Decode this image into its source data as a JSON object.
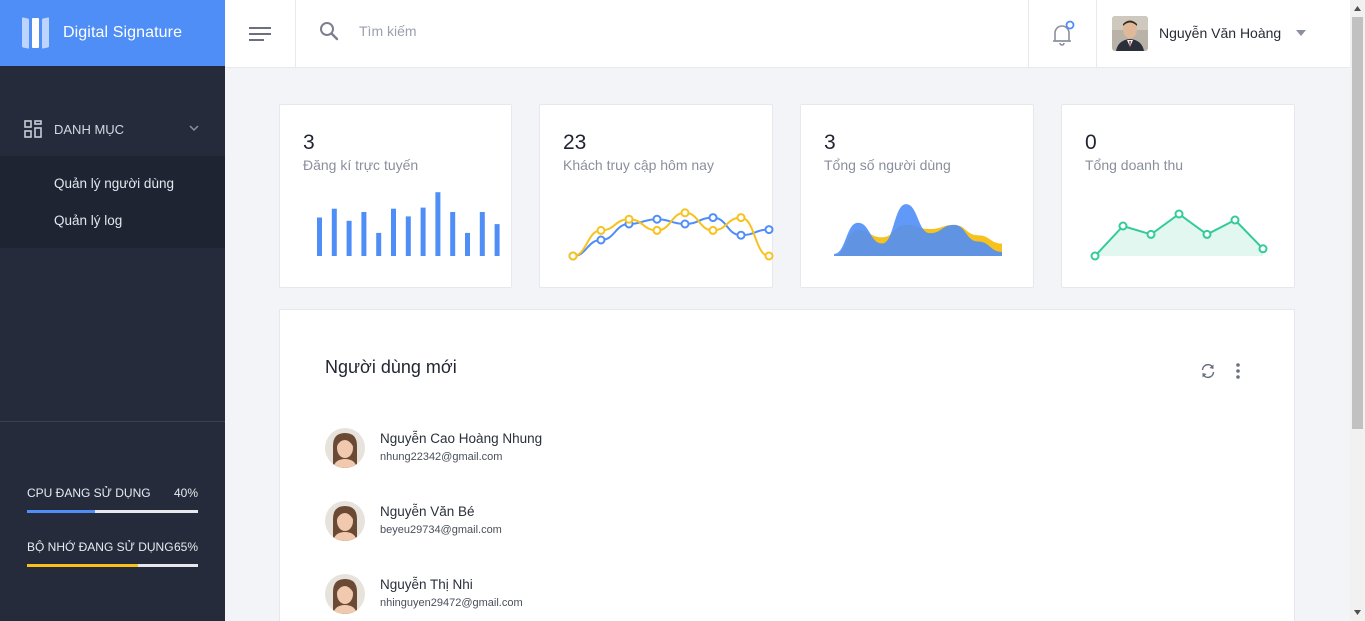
{
  "brand": {
    "title": "Digital Signature"
  },
  "sidebar": {
    "section_label": "DANH MỤC",
    "items": [
      {
        "label": "Quản lý người dùng"
      },
      {
        "label": "Quản lý log"
      }
    ],
    "stats": [
      {
        "label": "CPU ĐANG SỬ DỤNG",
        "value": "40%",
        "fraction": 0.4,
        "color": "#4f8ef7"
      },
      {
        "label": "BỘ NHỚ ĐANG SỬ DỤNG",
        "value": "65%",
        "fraction": 0.65,
        "color": "#f7c21e"
      }
    ]
  },
  "topbar": {
    "search_placeholder": "Tìm kiếm",
    "user_name": "Nguyễn Văn Hoàng"
  },
  "cards": [
    {
      "value": "3",
      "label": "Đăng kí trực tuyến",
      "color": "#4f8ef7"
    },
    {
      "value": "23",
      "label": "Khách truy cập hôm nay",
      "colors": [
        "#4f8ef7",
        "#f7c21e"
      ]
    },
    {
      "value": "3",
      "label": "Tổng số người dùng",
      "colors": [
        "#f7c21e",
        "#4f8ef7"
      ]
    },
    {
      "value": "0",
      "label": "Tổng doanh thu",
      "color": "#33cc99"
    }
  ],
  "chart_data": [
    {
      "type": "bar",
      "values": [
        3.5,
        4.3,
        3.2,
        4.0,
        2.1,
        4.3,
        3.6,
        4.4,
        5.8,
        4.0,
        2.1,
        4.0,
        2.9
      ]
    },
    {
      "type": "line",
      "series": [
        {
          "values": [
            0,
            2,
            4,
            4.6,
            4.0,
            4.8,
            2.6,
            3.3
          ]
        },
        {
          "values": [
            0,
            3.2,
            4.6,
            3.2,
            5.4,
            3.2,
            4.8,
            0
          ]
        }
      ]
    },
    {
      "type": "area",
      "series": [
        {
          "values": [
            0,
            2.5,
            1.8,
            3.0,
            2.6,
            3.0,
            2.0,
            1.2
          ]
        },
        {
          "values": [
            0.2,
            3.2,
            1.2,
            5.0,
            2.2,
            3.0,
            1.4,
            0.4
          ]
        }
      ]
    },
    {
      "type": "line",
      "values": [
        0,
        2.5,
        1.8,
        3.5,
        1.8,
        3.0,
        0.6
      ]
    }
  ],
  "panel": {
    "title": "Người dùng mới",
    "users": [
      {
        "name": "Nguyễn Cao Hoàng Nhung",
        "email": "nhung22342@gmail.com"
      },
      {
        "name": "Nguyễn Văn Bé",
        "email": "beyeu29734@gmail.com"
      },
      {
        "name": "Nguyễn Thị Nhi",
        "email": "nhinguyen29472@gmail.com"
      }
    ]
  }
}
